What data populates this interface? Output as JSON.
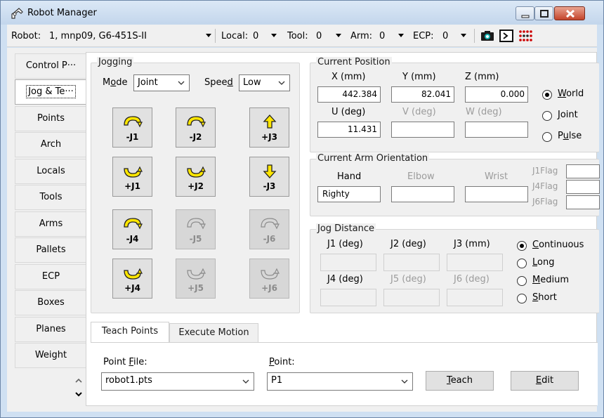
{
  "window": {
    "title": "Robot Manager"
  },
  "toolbar": {
    "robot_label": "Robot:",
    "robot_value": "1, mnp09, G6-451S-II",
    "local_label": "Local:",
    "local_value": "0",
    "tool_label": "Tool:",
    "tool_value": "0",
    "arm_label": "Arm:",
    "arm_value": "0",
    "ecp_label": "ECP:",
    "ecp_value": "0"
  },
  "side_tabs": [
    {
      "label": "Control P···"
    },
    {
      "label": "Jog & Te···"
    },
    {
      "label": "Points"
    },
    {
      "label": "Arch"
    },
    {
      "label": "Locals"
    },
    {
      "label": "Tools"
    },
    {
      "label": "Arms"
    },
    {
      "label": "Pallets"
    },
    {
      "label": "ECP"
    },
    {
      "label": "Boxes"
    },
    {
      "label": "Planes"
    },
    {
      "label": "Weight"
    }
  ],
  "jogging": {
    "title": "Jogging",
    "mode_label_pre": "M",
    "mode_label_u": "o",
    "mode_label_post": "de",
    "mode_value": "Joint",
    "speed_label_pre": "Spee",
    "speed_label_u": "d",
    "speed_value": "Low",
    "buttons": [
      {
        "label": "-J1"
      },
      {
        "label": "-J2"
      },
      {
        "label": "+J3"
      },
      {
        "label": "+J1"
      },
      {
        "label": "+J2"
      },
      {
        "label": "-J3"
      },
      {
        "label": "-J4"
      },
      {
        "label": "-J5"
      },
      {
        "label": "-J6"
      },
      {
        "label": "+J4"
      },
      {
        "label": "+J5"
      },
      {
        "label": "+J6"
      }
    ]
  },
  "current_position": {
    "title": "Current Position",
    "x_label": "X (mm)",
    "x_value": "442.384",
    "y_label": "Y (mm)",
    "y_value": "82.041",
    "z_label": "Z (mm)",
    "z_value": "0.000",
    "u_label": "U (deg)",
    "u_value": "11.431",
    "v_label": "V (deg)",
    "v_value": "",
    "w_label": "W (deg)",
    "w_value": "",
    "world_pre": "",
    "world_u": "W",
    "world_post": "orld",
    "joint_pre": "",
    "joint_u": "J",
    "joint_post": "oint",
    "pulse_pre": "P",
    "pulse_u": "u",
    "pulse_post": "lse",
    "selected": "World"
  },
  "arm_orientation": {
    "title": "Current Arm Orientation",
    "hand_label": "Hand",
    "hand_value": "Righty",
    "elbow_label": "Elbow",
    "elbow_value": "",
    "wrist_label": "Wrist",
    "wrist_value": "",
    "j1flag_label": "J1Flag",
    "j4flag_label": "J4Flag",
    "j6flag_label": "J6Flag"
  },
  "jog_distance": {
    "title": "Jog Distance",
    "j1_label": "J1 (deg)",
    "j2_label": "J2 (deg)",
    "j3_label": "J3 (mm)",
    "j4_label": "J4 (deg)",
    "j5_label": "J5 (deg)",
    "j6_label": "J6 (deg)",
    "continuous_u": "C",
    "continuous_post": "ontinuous",
    "long_u": "L",
    "long_post": "ong",
    "medium_u": "M",
    "medium_post": "edium",
    "short_u": "S",
    "short_post": "hort",
    "selected": "Continuous"
  },
  "bottom_tabs": [
    {
      "label": "Teach Points"
    },
    {
      "label": "Execute Motion"
    }
  ],
  "teach": {
    "point_file_pre": "Point ",
    "point_file_u": "F",
    "point_file_post": "ile:",
    "point_file_value": "robot1.pts",
    "point_u": "P",
    "point_post": "oint:",
    "point_value": "P1",
    "teach_u": "T",
    "teach_post": "each",
    "edit_u": "E",
    "edit_post": "dit"
  },
  "colors": {
    "accent_yellow": "#ffe600",
    "titlebar": "#cfe0f2",
    "close": "#c4442b"
  }
}
